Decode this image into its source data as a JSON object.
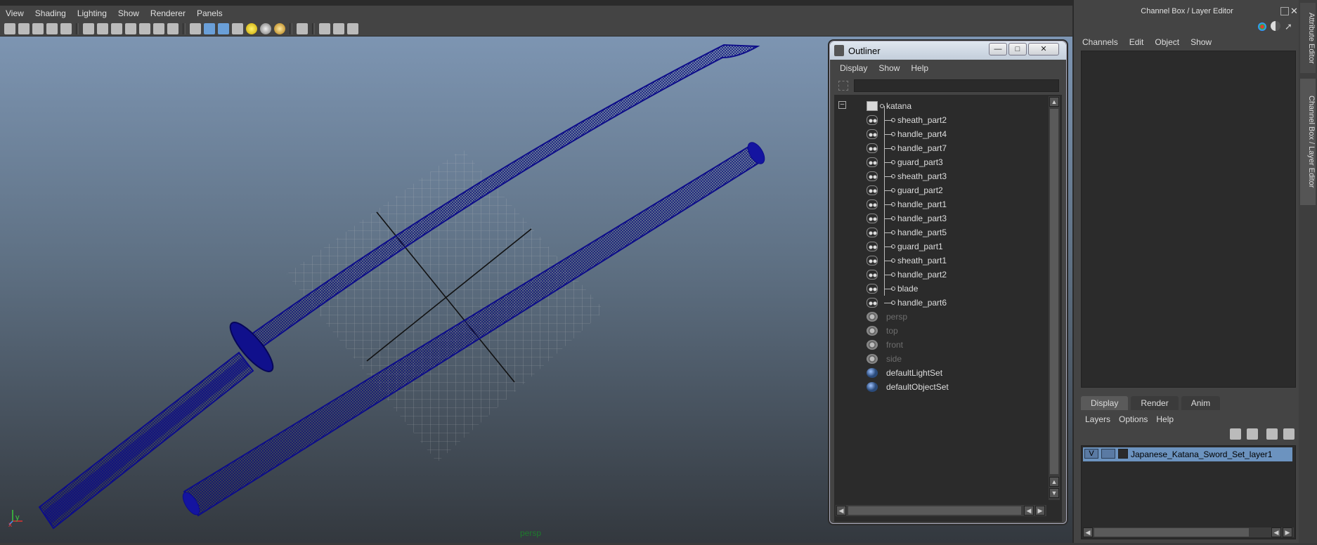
{
  "viewport": {
    "menu": [
      "View",
      "Shading",
      "Lighting",
      "Show",
      "Renderer",
      "Panels"
    ],
    "camera_label": "persp",
    "axis_labels": {
      "x": "x",
      "y": "y"
    }
  },
  "outliner": {
    "title": "Outliner",
    "window_buttons": {
      "minimize": "—",
      "maximize": "□",
      "close": "✕"
    },
    "menu": [
      "Display",
      "Show",
      "Help"
    ],
    "search_value": "",
    "root": "katana",
    "children": [
      "sheath_part2",
      "handle_part4",
      "handle_part7",
      "guard_part3",
      "sheath_part3",
      "guard_part2",
      "handle_part1",
      "handle_part3",
      "handle_part5",
      "guard_part1",
      "sheath_part1",
      "handle_part2",
      "blade",
      "handle_part6"
    ],
    "cameras": [
      "persp",
      "top",
      "front",
      "side"
    ],
    "sets": [
      "defaultLightSet",
      "defaultObjectSet"
    ],
    "collapse_symbol": "–"
  },
  "channel_box": {
    "title": "Channel Box / Layer Editor",
    "menu": [
      "Channels",
      "Edit",
      "Object",
      "Show"
    ]
  },
  "layer_editor": {
    "tabs": [
      "Display",
      "Render",
      "Anim"
    ],
    "active_tab": "Display",
    "menu": [
      "Layers",
      "Options",
      "Help"
    ],
    "layer": {
      "visible_flag": "V",
      "name": "Japanese_Katana_Sword_Set_layer1"
    }
  },
  "side_tabs": [
    "Attribute Editor",
    "Channel Box / Layer Editor"
  ],
  "colors": {
    "wireframe": "#0d0d8a",
    "grid": "#bfbfbf",
    "selection": "#6c93bf",
    "camera_label": "#1e7a2c"
  }
}
